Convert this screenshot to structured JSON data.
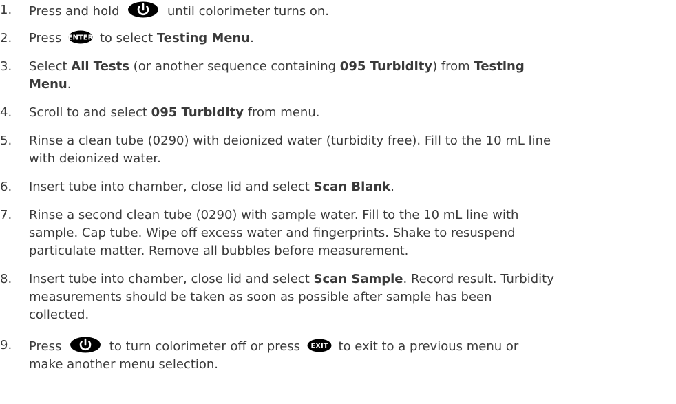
{
  "steps": [
    {
      "number": "1.",
      "before": "Press and hold",
      "icon": "power-button-icon",
      "after": "until colorimeter turns on."
    },
    {
      "number": "2.",
      "before": "Press",
      "icon": "enter-button-icon",
      "icon_label": "ENTER",
      "mid": "to select",
      "bold": "Testing Menu",
      "end": "."
    },
    {
      "number": "3.",
      "line1_a": "Select",
      "line1_b": "All Tests",
      "line1_c": "(or another sequence containing",
      "line1_d": "095 Turbidity",
      "line1_e": ") from",
      "line1_f": "Testing",
      "line2_a": "Menu",
      "line2_b": "."
    },
    {
      "number": "4.",
      "a": "Scroll to and select",
      "b": "095 Turbidity",
      "c": "from menu."
    },
    {
      "number": "5.",
      "line1": "Rinse a clean tube (0290) with deionized water (turbidity free). Fill to the 10 mL line",
      "line2": "with deionized water."
    },
    {
      "number": "6.",
      "a": "Insert tube into chamber, close lid and select",
      "b": "Scan Blank",
      "c": "."
    },
    {
      "number": "7.",
      "line1": "Rinse a second clean tube (0290) with sample water. Fill to the 10 mL line with",
      "line2": "sample. Cap tube. Wipe off excess water and fingerprints. Shake to resuspend",
      "line3": "particulate matter. Remove all bubbles before measurement."
    },
    {
      "number": "8.",
      "line1_a": "Insert tube into chamber, close lid and select",
      "line1_b": "Scan Sample",
      "line1_c": ". Record result. Turbidity",
      "line2": "measurements should be taken as soon as possible after sample has been",
      "line3": "collected."
    },
    {
      "number": "9.",
      "line1_a": "Press",
      "line1_icon1": "power-button-icon",
      "line1_b": "to turn colorimeter off or press",
      "line1_icon2": "exit-button-icon",
      "line1_icon2_label": "EXIT",
      "line1_c": "to exit to a previous menu or",
      "line2": "make another menu selection."
    }
  ],
  "colors": {
    "text": "#3a3a3a",
    "icon_fill": "#000000",
    "icon_text": "#ffffff"
  }
}
